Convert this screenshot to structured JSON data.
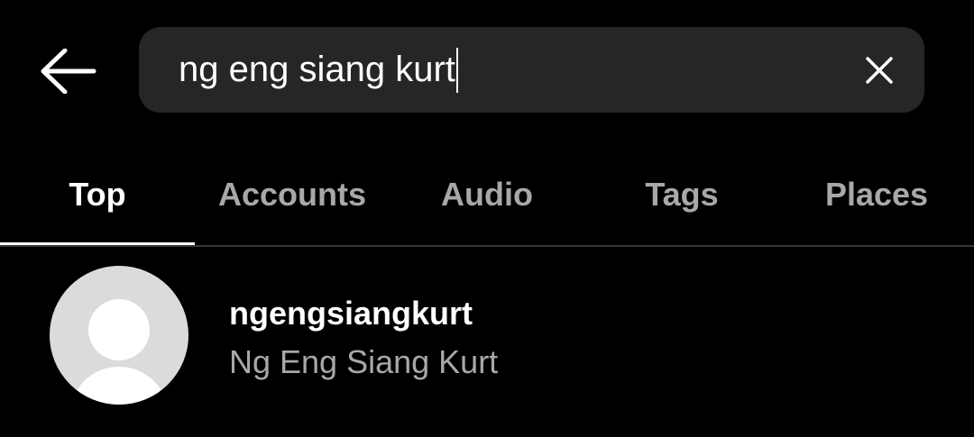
{
  "header": {
    "back_icon": "arrow-left-icon",
    "search": {
      "value": "ng eng siang kurt",
      "clear_icon": "close-icon"
    }
  },
  "tabs": [
    {
      "label": "Top",
      "active": true
    },
    {
      "label": "Accounts",
      "active": false
    },
    {
      "label": "Audio",
      "active": false
    },
    {
      "label": "Tags",
      "active": false
    },
    {
      "label": "Places",
      "active": false
    }
  ],
  "results": [
    {
      "username": "ngengsiangkurt",
      "full_name": "Ng Eng Siang Kurt",
      "avatar_icon": "default-avatar-icon"
    }
  ],
  "colors": {
    "background": "#000000",
    "search_bg": "#262626",
    "text_primary": "#ffffff",
    "text_secondary": "#a8a8a8",
    "divider": "#363636",
    "avatar_bg": "#dbdbdb"
  }
}
